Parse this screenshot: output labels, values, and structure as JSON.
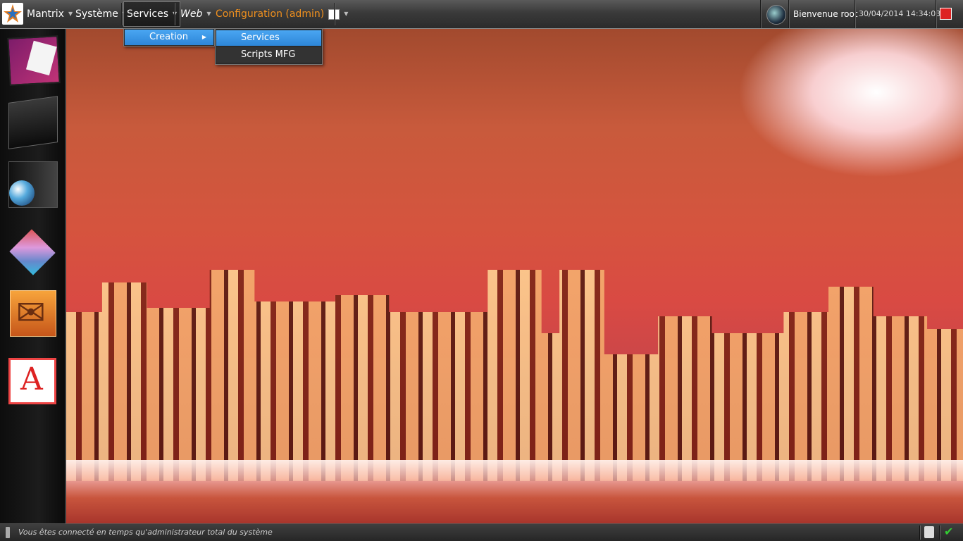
{
  "menubar": {
    "items": [
      {
        "label": "Mantrix"
      },
      {
        "label": "Système"
      },
      {
        "label": "Services"
      },
      {
        "label": "Web"
      },
      {
        "label": "Configuration (admin)"
      }
    ],
    "active": "Services"
  },
  "header_right": {
    "welcome": "Bienvenue root",
    "datetime": "30/04/2014 14:34:03"
  },
  "dropdown": {
    "level1": [
      {
        "label": "Creation",
        "highlighted": true,
        "has_submenu": true
      }
    ],
    "level2": [
      {
        "label": "Services",
        "highlighted": true
      },
      {
        "label": "Scripts MFG",
        "highlighted": false
      }
    ]
  },
  "dock": {
    "icons": [
      "photos-icon",
      "terminal-icon",
      "web-browser-icon",
      "blocks-icon",
      "mail-icon",
      "pdf-reader-icon"
    ]
  },
  "statusbar": {
    "message": "Vous êtes connecté en temps qu'administrateur total du système"
  },
  "colors": {
    "accent": "#2d86d8",
    "config_text": "#f0901e"
  }
}
